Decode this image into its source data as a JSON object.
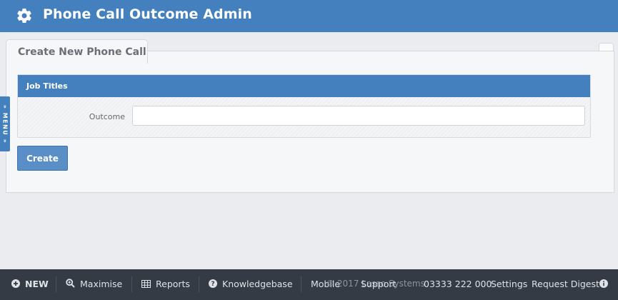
{
  "header": {
    "title": "Phone Call Outcome Admin",
    "icon": "gear-icon"
  },
  "tab": {
    "label": "Create New Phone Call"
  },
  "form": {
    "section_title": "Job Titles",
    "outcome_label": "Outcome",
    "outcome_value": "",
    "create_label": "Create"
  },
  "menu_tab": {
    "label": "» MENU »"
  },
  "footer": {
    "new_label": "NEW",
    "maximise_label": "Maximise",
    "reports_label": "Reports",
    "knowledgebase_label": "Knowledgebase",
    "mobile_label": "Mobile",
    "copyright": "© 2017 Lasso Systems",
    "support_label": "Support",
    "phone": "03333 222 000",
    "settings_label": "Settings",
    "request_digest_label": "Request Digest"
  },
  "colors": {
    "brand": "#4380bd",
    "footer_bg": "#353b45",
    "page_bg": "#ebecef"
  }
}
